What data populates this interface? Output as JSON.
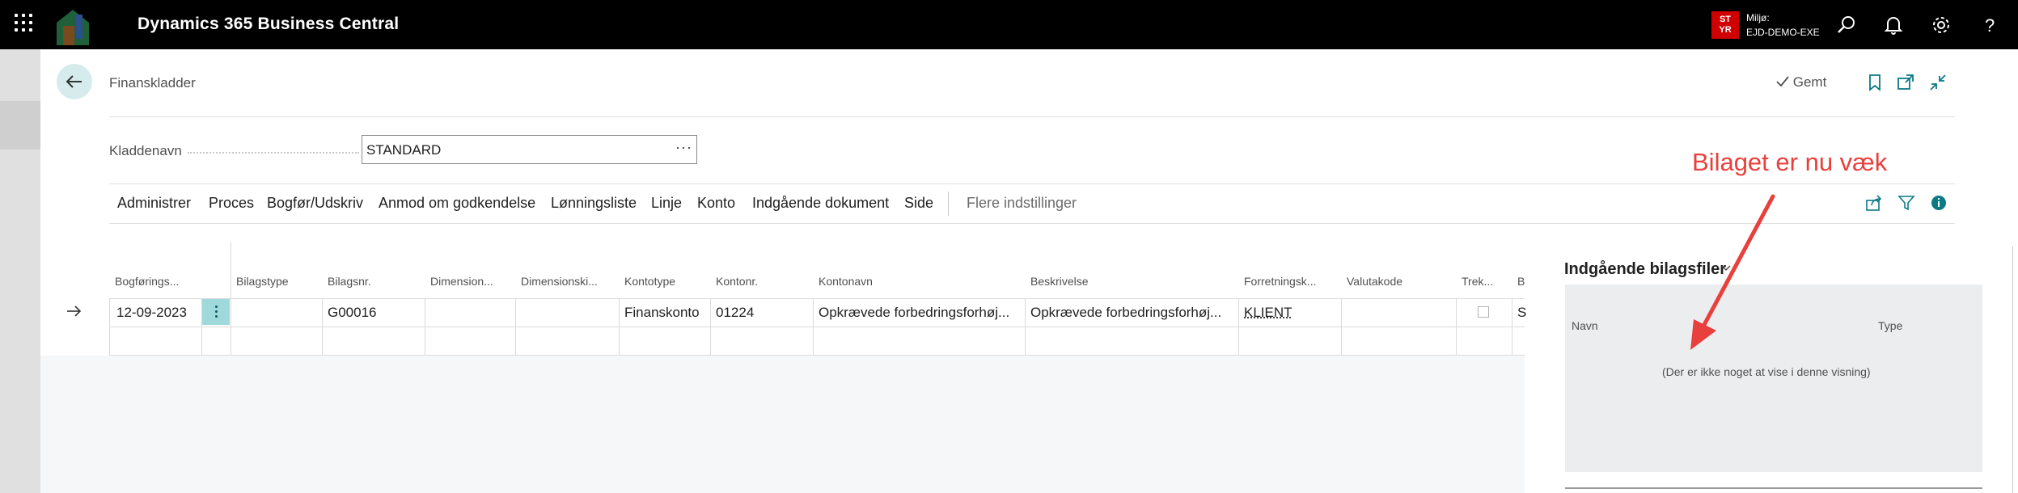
{
  "topbar": {
    "app_title": "Dynamics 365 Business Central",
    "env_badge_line1": "ST",
    "env_badge_line2": "YR",
    "env_label": "Miljø:",
    "env_name": "EJD-DEMO-EXE"
  },
  "header": {
    "page_title": "Finanskladder",
    "saved_label": "Gemt"
  },
  "batch": {
    "label": "Kladdenavn",
    "value": "STANDARD",
    "ellipsis": "···"
  },
  "actions": {
    "items": [
      "Administrer",
      "Proces",
      "Bogfør/Udskriv",
      "Anmod om godkendelse",
      "Lønningsliste",
      "Linje",
      "Konto",
      "Indgående dokument",
      "Side"
    ],
    "more": "Flere indstillinger"
  },
  "grid": {
    "columns": [
      "Bogførings...",
      "Bilagstype",
      "Bilagsnr.",
      "Dimension...",
      "Dimensionski...",
      "Kontotype",
      "Kontonr.",
      "Kontonavn",
      "Beskrivelse",
      "Forretningsk...",
      "Valutakode",
      "Trek...",
      "B"
    ],
    "row": {
      "date": "12-09-2023",
      "doc_type": "",
      "doc_no": "G00016",
      "dim1": "",
      "dim2": "",
      "account_type": "Finanskonto",
      "account_no": "01224",
      "account_name": "Opkrævede forbedringsforhøj...",
      "description": "Opkrævede forbedringsforhøj...",
      "business": "KLIENT",
      "currency": "",
      "last": "S"
    }
  },
  "factbox": {
    "title": "Indgående bilagsfiler",
    "col_name": "Navn",
    "col_type": "Type",
    "empty_text": "(Der er ikke noget at vise i denne visning)"
  },
  "annotation": {
    "text": "Bilaget er nu væk",
    "color": "#e8403c"
  },
  "colors": {
    "topbar": "#000000",
    "env_badge": "#d00000",
    "accent_teal": "#0a7a86",
    "selected_cell": "#9fd9db"
  }
}
